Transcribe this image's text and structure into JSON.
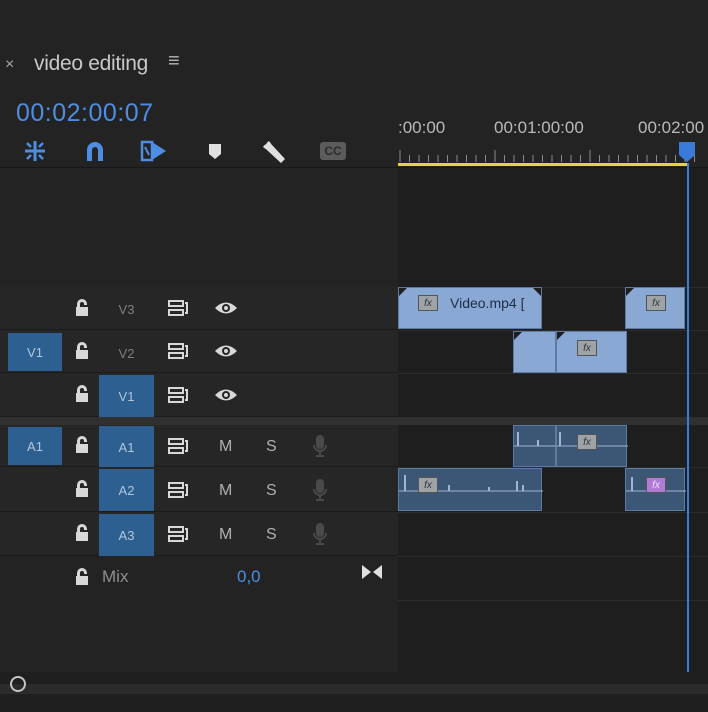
{
  "panel": {
    "close_glyph": "×",
    "title": "video editing",
    "menu_glyph": "≡",
    "timecode": "00:02:00:07"
  },
  "toolbar": {
    "tools": [
      {
        "name": "insert-nest-icon"
      },
      {
        "name": "snap-magnet-icon"
      },
      {
        "name": "linked-selection-icon"
      },
      {
        "name": "add-marker-icon"
      },
      {
        "name": "wrench-settings-icon"
      },
      {
        "name": "captions-icon",
        "label": "CC"
      }
    ]
  },
  "ruler": {
    "times": [
      ":00:00",
      "00:01:00:00",
      "00:02:00"
    ]
  },
  "tracks": {
    "video": [
      {
        "label": "V3",
        "source_patch": "",
        "targeted": false
      },
      {
        "label": "V2",
        "source_patch": "V1",
        "targeted": false
      },
      {
        "label": "V1",
        "source_patch": "",
        "targeted": true
      }
    ],
    "audio": [
      {
        "label": "A1",
        "source_patch": "A1",
        "targeted": true,
        "mute": "M",
        "solo": "S"
      },
      {
        "label": "A2",
        "source_patch": "",
        "targeted": true,
        "mute": "M",
        "solo": "S"
      },
      {
        "label": "A3",
        "source_patch": "",
        "targeted": true,
        "mute": "M",
        "solo": "S"
      }
    ],
    "mix": {
      "label": "Mix",
      "value": "0,0"
    }
  },
  "clips": {
    "v3_clip1_name": "Video.mp4 [",
    "fx_label": "fx"
  },
  "colors": {
    "accent": "#4d8ee3",
    "work_area": "#e3d63c",
    "video_clip": "#8aa8d4",
    "audio_clip": "#3c5775",
    "track_target": "#2d5f91"
  }
}
